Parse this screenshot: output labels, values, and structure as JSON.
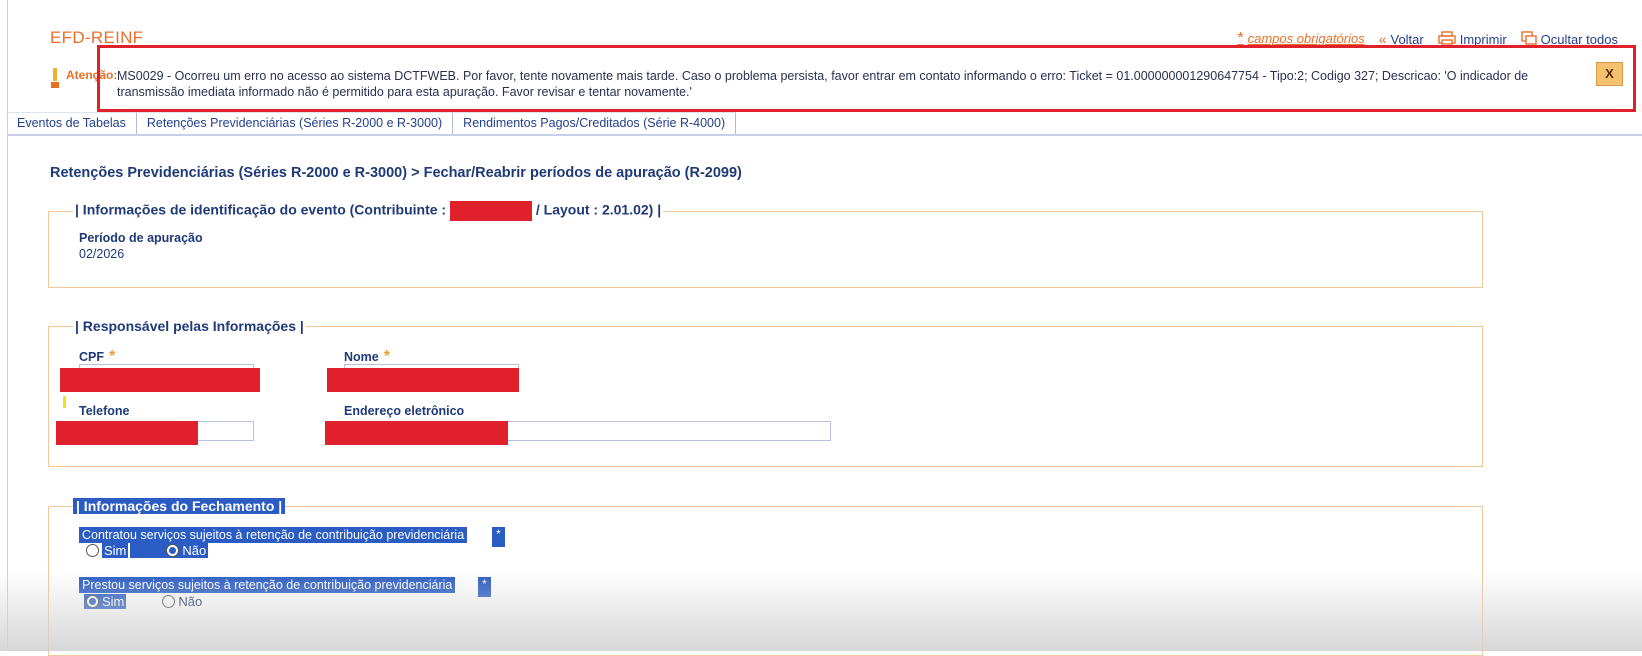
{
  "app": {
    "title": "EFD-REINF"
  },
  "header": {
    "required_label": "campos obrigatórios",
    "back_label": "Voltar",
    "print_label": "Imprimir",
    "hide_label": "Ocultar todos"
  },
  "alert": {
    "label": "Atenção:",
    "message": "MS0029 - Ocorreu um erro no acesso ao sistema DCTFWEB. Por favor, tente novamente mais tarde. Caso o problema persista, favor entrar em contato informando o erro: Ticket = 01.000000001290647754 - Tipo:2; Codigo 327; Descricao: 'O indicador de transmissão imediata informado não é permitido para esta apuração. Favor revisar e tentar novamente.'",
    "close_label": "X"
  },
  "tabs": [
    {
      "label": "Eventos de Tabelas"
    },
    {
      "label": "Retenções Previdenciárias (Séries R-2000 e R-3000)"
    },
    {
      "label": "Rendimentos Pagos/Creditados (Série R-4000)"
    }
  ],
  "breadcrumb": "Retenções Previdenciárias (Séries R-2000 e R-3000) > Fechar/Reabrir períodos de apuração (R-2099)",
  "identification": {
    "legend_prefix": "| Informações de identificação do evento (Contribuinte :",
    "legend_suffix": "/ Layout : 2.01.02) |",
    "period_label": "Período de apuração",
    "period_value": "02/2026"
  },
  "responsible": {
    "legend": "| Responsável pelas Informações |",
    "cpf_label": "CPF",
    "name_label": "Nome",
    "phone_label": "Telefone",
    "email_label": "Endereço eletrônico"
  },
  "closing": {
    "legend": "| Informações do Fechamento |",
    "questions": [
      {
        "text": "Contratou serviços sujeitos à retenção de contribuição previdenciária",
        "options": [
          "Sim",
          "Não"
        ],
        "selected": "Não"
      },
      {
        "text": "Prestou serviços sujeitos à retenção de contribuição previdenciária",
        "options": [
          "Sim",
          "Não"
        ],
        "selected": "Sim"
      }
    ]
  }
}
